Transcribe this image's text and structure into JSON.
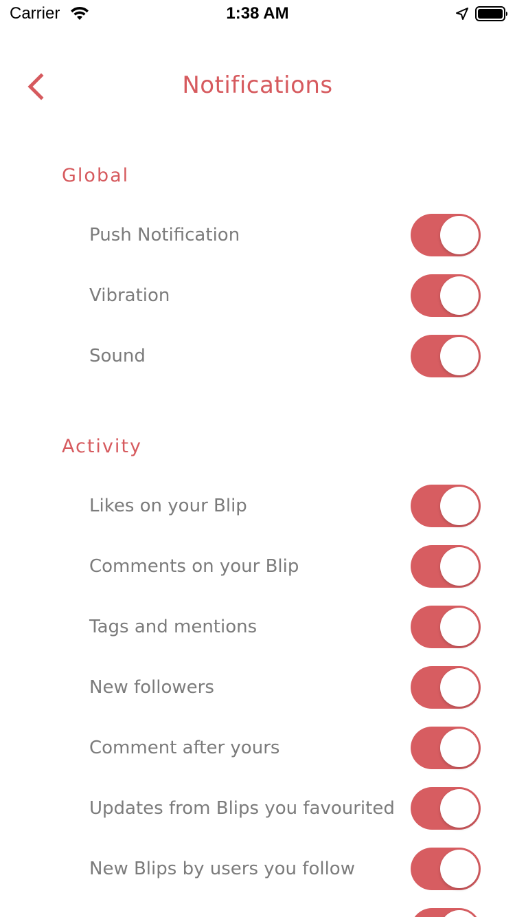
{
  "status_bar": {
    "carrier": "Carrier",
    "time": "1:38 AM",
    "icons": [
      "wifi-icon",
      "location-arrow-icon",
      "battery-icon"
    ]
  },
  "nav": {
    "title": "Notifications",
    "back_icon": "chevron-left-icon"
  },
  "colors": {
    "accent": "#d65a5e",
    "toggle_on": "#d75d61",
    "label_text": "#7b7b7b",
    "background": "#ffffff"
  },
  "sections": [
    {
      "title": "Global",
      "items": [
        {
          "label": "Push Notification",
          "enabled": true
        },
        {
          "label": "Vibration",
          "enabled": true
        },
        {
          "label": "Sound",
          "enabled": true
        }
      ]
    },
    {
      "title": "Activity",
      "items": [
        {
          "label": "Likes on your Blip",
          "enabled": true
        },
        {
          "label": "Comments on your Blip",
          "enabled": true
        },
        {
          "label": "Tags and mentions",
          "enabled": true
        },
        {
          "label": "New followers",
          "enabled": true
        },
        {
          "label": "Comment after yours",
          "enabled": true
        },
        {
          "label": "Updates from Blips you favourited",
          "enabled": true
        },
        {
          "label": "New Blips by users you follow",
          "enabled": true
        }
      ]
    }
  ]
}
